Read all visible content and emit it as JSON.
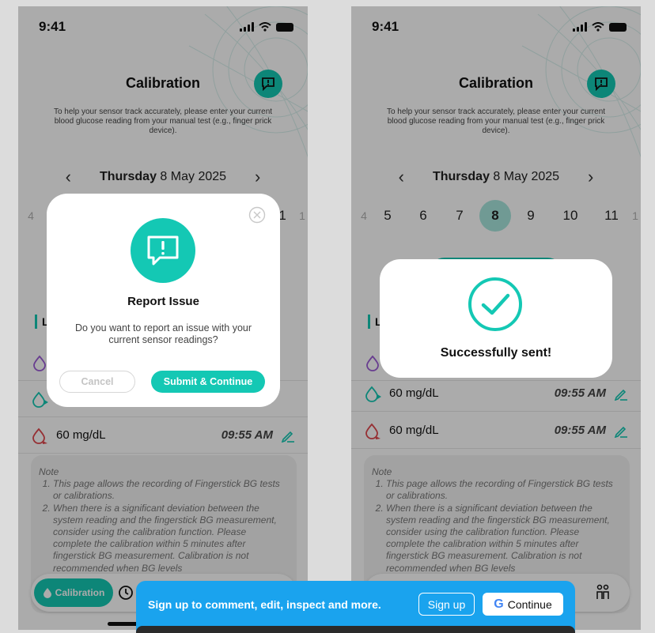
{
  "status": {
    "time": "9:41"
  },
  "screen": {
    "title": "Calibration",
    "intro": "To help your sensor track accurately, please enter your current blood glucose reading  from your manual test (e.g., finger prick device).",
    "date_weekday": "Thursday",
    "date_rest": "8 May 2025",
    "prev_arrow": "‹",
    "next_arrow": "›",
    "days": [
      "4",
      "5",
      "6",
      "7",
      "8",
      "9",
      "10",
      "11",
      "1"
    ],
    "selected_day": "8",
    "logs_title": "L"
  },
  "logs": [
    {
      "icon": "purple-drop-icon",
      "value": "",
      "time": ""
    },
    {
      "icon": "teal-drop-icon",
      "value": "60 mg/dL",
      "time": "09:55 AM"
    },
    {
      "icon": "red-drop-icon",
      "value": "60 mg/dL",
      "time": "09:55 AM"
    }
  ],
  "note": {
    "label": "Note",
    "items": [
      "This page allows the recording of Fingerstick BG tests or calibrations.",
      "When there is a significant deviation between the system reading and the fingerstick BG measurement, consider using the calibration function. Please complete the calibration within 5 minutes after fingerstick BG measurement. Calibration is not recommended when BG levels"
    ]
  },
  "tabbar": {
    "calibration_label": "Calibration"
  },
  "report_modal": {
    "title": "Report Issue",
    "text": "Do you want to report an issue with your current sensor readings?",
    "cancel_label": "Cancel",
    "submit_label": "Submit & Continue"
  },
  "success_modal": {
    "text": "Successfully sent!"
  },
  "signup_banner": {
    "text": "Sign up to comment, edit, inspect and more.",
    "signup_label": "Sign up",
    "continue_label": "Continue",
    "google_letter": "G"
  },
  "colors": {
    "accent": "#14c8b4",
    "banner": "#1aa3ee"
  }
}
